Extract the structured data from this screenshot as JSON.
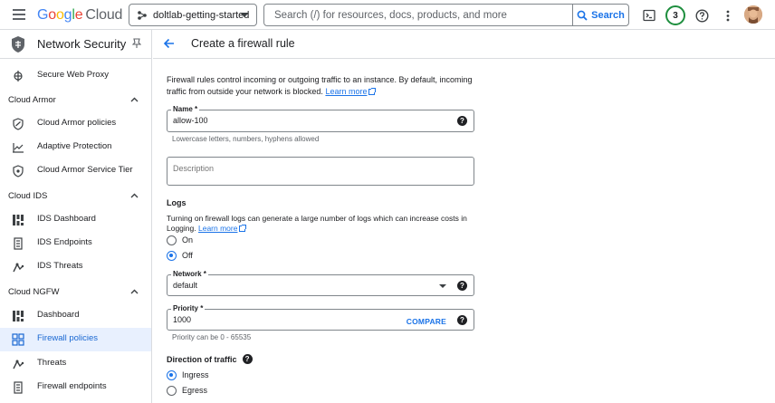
{
  "topbar": {
    "logo_google": "Google",
    "logo_cloud": "Cloud",
    "project": "doltlab-getting-started",
    "search_placeholder": "Search (/) for resources, docs, products, and more",
    "search_button": "Search",
    "notifications_count": "3"
  },
  "sidebar": {
    "title": "Network Security",
    "top_item": "Secure Web Proxy",
    "sections": [
      {
        "label": "Cloud Armor",
        "items": [
          "Cloud Armor policies",
          "Adaptive Protection",
          "Cloud Armor Service Tier"
        ]
      },
      {
        "label": "Cloud IDS",
        "items": [
          "IDS Dashboard",
          "IDS Endpoints",
          "IDS Threats"
        ]
      },
      {
        "label": "Cloud NGFW",
        "items": [
          "Dashboard",
          "Firewall policies",
          "Threats",
          "Firewall endpoints"
        ]
      }
    ],
    "active_item": "Firewall policies"
  },
  "main": {
    "title": "Create a firewall rule",
    "intro_text": "Firewall rules control incoming or outgoing traffic to an instance. By default, incoming traffic from outside your network is blocked.",
    "learn_more": "Learn more",
    "name": {
      "label": "Name *",
      "value": "allow-100",
      "hint": "Lowercase letters, numbers, hyphens allowed"
    },
    "description": {
      "placeholder": "Description",
      "value": ""
    },
    "logs": {
      "title": "Logs",
      "desc": "Turning on firewall logs can generate a large number of logs which can increase costs in Logging.",
      "learn_more": "Learn more",
      "options": [
        "On",
        "Off"
      ],
      "selected": "Off"
    },
    "network": {
      "label": "Network *",
      "value": "default"
    },
    "priority": {
      "label": "Priority *",
      "value": "1000",
      "compare": "COMPARE",
      "hint": "Priority can be 0 - 65535"
    },
    "direction": {
      "title": "Direction of traffic",
      "options": [
        "Ingress",
        "Egress"
      ],
      "selected": "Ingress"
    }
  }
}
